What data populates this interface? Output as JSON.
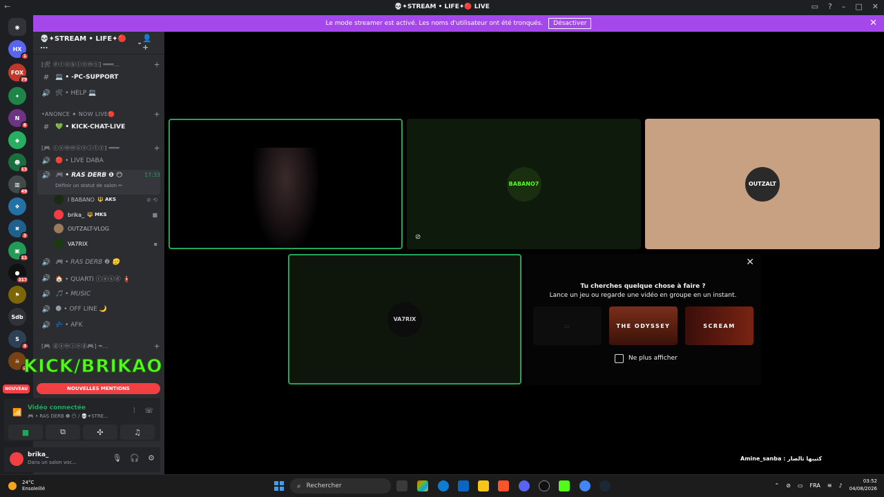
{
  "window": {
    "title": "💀✦STREAM • LIFE✦🔴 LIVE",
    "nav_back": "←",
    "nav_forward": "→"
  },
  "banner": {
    "text": "Le mode streamer est activé. Les noms d'utilisateur ont été tronqués.",
    "button": "Désactiver",
    "close": "✕"
  },
  "server": {
    "name": "💀✦STREAM • LIFE✦🔴 ...",
    "chevron": "⌄",
    "invite_icon": "👤+"
  },
  "channels": {
    "cat_problems": "[🛠 ⓟⓡⓞⓑⓛⓔⓜⓢ] ═══...",
    "pc_support": "💻 • -PC-SUPPORT",
    "help": "🛠 • HELP 💻",
    "cat_anonce": "•ANONCE ✦ NOW LIVE🔴",
    "kick_chat": "💚 • KICK-CHAT-LIVE",
    "cat_community": "[🎮 ⓒⓞⓜⓜⓤⓝⓘⓣⓨ] ═══",
    "live_daba": "🔴 • LIVE DABA",
    "ras_derb": "🎮 • RAS DERB ❶ 😶",
    "ras_derb_time": "17:33",
    "ras_derb_status": "Définir un statut de salon ✏",
    "ras_derb2": "🎮 • RAS DERB ❷ 🫡",
    "quarti": "🏠 • QUARTI ⓡⓐⓢⓓ 🧯",
    "music": "🎵 • MUSIC",
    "offline": "🌑 • OFF LINE 🌙",
    "afk": "💤 • AFK",
    "cat_gaming": "[🎮 ⓖⓐⓜⓘⓝⓖ🎮] ═..."
  },
  "voice_users": [
    {
      "name": "l BABANO",
      "tag": "🔱 AKS",
      "avatar_color": "#1b2a12"
    },
    {
      "name": "brika_",
      "tag": "🔱 MKS",
      "avatar_color": "#f23f43"
    },
    {
      "name": "OUTZALT-VLOG",
      "tag": "",
      "avatar_color": "#9c7a5c"
    },
    {
      "name": "VA7RIX",
      "tag": "",
      "avatar_color": "#1b3a12"
    }
  ],
  "overlay": {
    "kick_text": "KICK/BRIKAO"
  },
  "mentions": {
    "nouveau": "NOUVEAU",
    "label": "NOUVELLES MENTIONS"
  },
  "voice_panel": {
    "title": "Vidéo connectée",
    "subtitle": "🎮 • RAS DERB ❶ 😶 / 💀✦STRE...",
    "signal_icon": "📶"
  },
  "user_panel": {
    "name": "brika_",
    "sub": "Dans un salon voc..."
  },
  "activity": {
    "close": "✕",
    "line1": "Tu cherches quelque chose à faire ?",
    "line2": "Lance un jeu ou regarde une vidéo en groupe en un instant.",
    "card_odyssey": "THE ODYSSEY",
    "card_scream": "SCREAM",
    "checkbox_label": "Ne plus afficher"
  },
  "tiles": {
    "babano_logo": "BABANO7",
    "outzalt_logo": "OUTZALT",
    "va7rix_logo": "VA7RIX"
  },
  "watermark": "Amine_sanba : كتيبها ثالصار",
  "taskbar": {
    "temp": "24°C",
    "weather": "Ensoleillé",
    "search": "Rechercher",
    "lang": "FRA",
    "time": "03:52",
    "date": "04/08/2026"
  },
  "colors": {
    "accent": "#a448ec",
    "green": "#23a55a",
    "kick_green": "#53fc18",
    "red": "#f23f43"
  }
}
